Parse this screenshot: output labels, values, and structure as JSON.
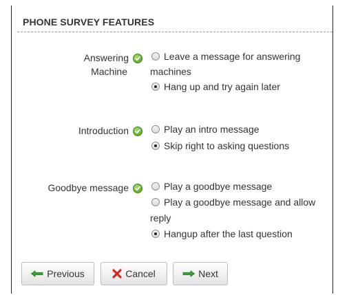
{
  "section": {
    "title": "PHONE SURVEY FEATURES"
  },
  "fields": [
    {
      "label_lines": [
        "Answering",
        "Machine"
      ],
      "options": [
        {
          "lines": [
            "Leave a message for answering",
            "machines"
          ],
          "checked": false
        },
        {
          "lines": [
            "Hang up and try again later"
          ],
          "checked": true
        }
      ]
    },
    {
      "label_lines": [
        "Introduction"
      ],
      "options": [
        {
          "lines": [
            "Play an intro message"
          ],
          "checked": false
        },
        {
          "lines": [
            "Skip right to asking questions"
          ],
          "checked": true
        }
      ]
    },
    {
      "label_lines": [
        "Goodbye message"
      ],
      "options": [
        {
          "lines": [
            "Play a goodbye message"
          ],
          "checked": false
        },
        {
          "lines": [
            "Play a goodbye message and allow",
            "reply"
          ],
          "checked": false
        },
        {
          "lines": [
            "Hangup after the last question"
          ],
          "checked": true
        }
      ]
    }
  ],
  "buttons": {
    "previous": "Previous",
    "cancel": "Cancel",
    "next": "Next"
  },
  "colors": {
    "valid_icon": "#5aa825",
    "arrow_green": "#3aa335",
    "cancel_red": "#d42a1d"
  }
}
